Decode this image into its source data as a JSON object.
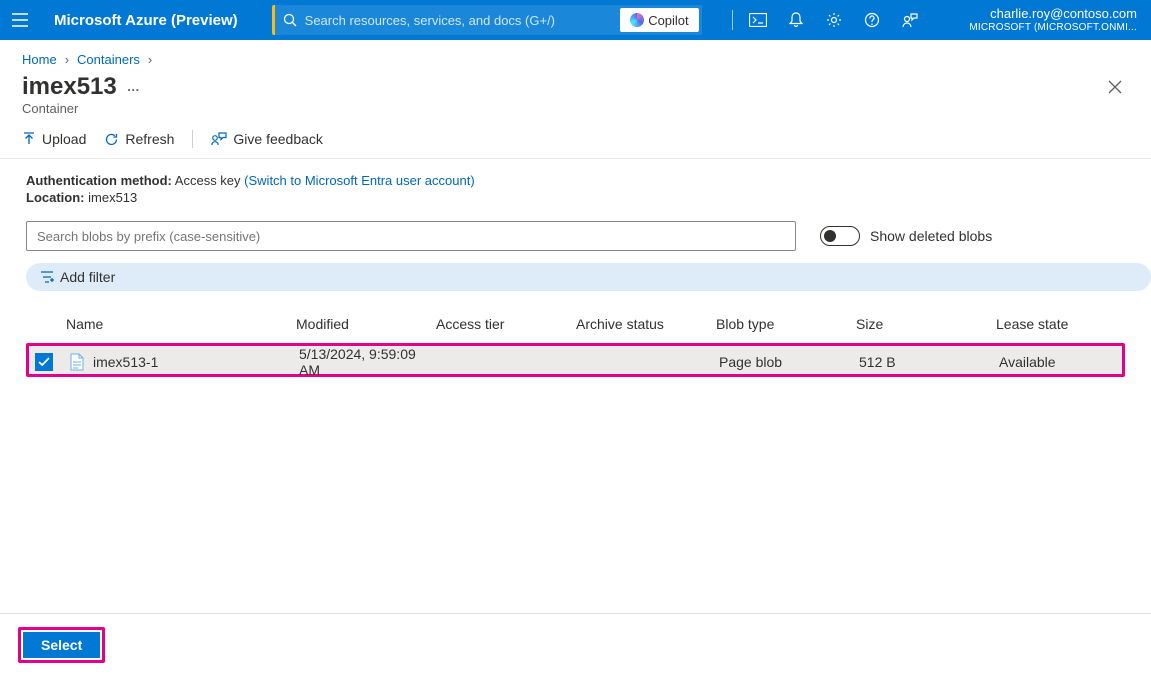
{
  "topbar": {
    "brand": "Microsoft Azure (Preview)",
    "search_placeholder": "Search resources, services, and docs (G+/)",
    "copilot_label": "Copilot",
    "account_email": "charlie.roy@contoso.com",
    "account_tenant": "MICROSOFT (MICROSOFT.ONMI..."
  },
  "breadcrumb": {
    "items": [
      {
        "label": "Home"
      },
      {
        "label": "Containers"
      }
    ]
  },
  "page": {
    "title": "imex513",
    "subtitle": "Container"
  },
  "commands": {
    "upload": "Upload",
    "refresh": "Refresh",
    "feedback": "Give feedback"
  },
  "meta": {
    "auth_label": "Authentication method:",
    "auth_value": "Access key",
    "auth_link": "(Switch to Microsoft Entra user account)",
    "location_label": "Location:",
    "location_value": "imex513"
  },
  "filter": {
    "search_placeholder": "Search blobs by prefix (case-sensitive)",
    "toggle_label": "Show deleted blobs",
    "add_filter_label": "Add filter"
  },
  "table": {
    "columns": [
      "Name",
      "Modified",
      "Access tier",
      "Archive status",
      "Blob type",
      "Size",
      "Lease state"
    ],
    "rows": [
      {
        "name": "imex513-1",
        "modified": "5/13/2024, 9:59:09 AM",
        "access_tier": "",
        "archive_status": "",
        "blob_type": "Page blob",
        "size": "512 B",
        "lease_state": "Available",
        "selected": true
      }
    ]
  },
  "footer": {
    "select_label": "Select"
  }
}
